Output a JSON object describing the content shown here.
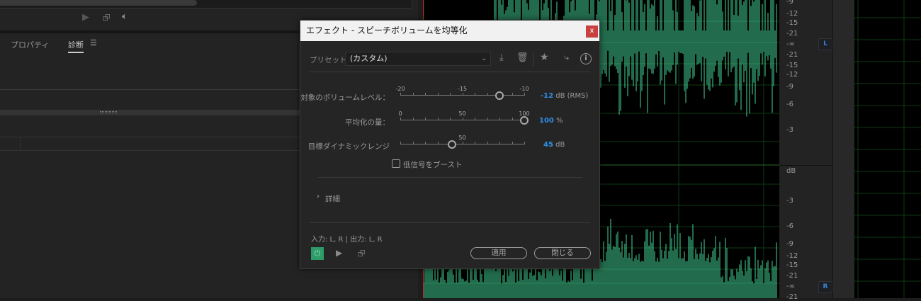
{
  "left_panel": {
    "tabs": [
      {
        "label": "プロパティ"
      },
      {
        "label": "診断",
        "active": true
      }
    ],
    "menu_icon": "hamburger-icon"
  },
  "ruler": {
    "top_labels": [
      "-9",
      "-12",
      "-15",
      "-21",
      "-∞",
      "-21",
      "-15",
      "-12",
      "-9",
      "-6",
      "-3"
    ],
    "bottom_unit": "dB",
    "bottom_labels": [
      "-3",
      "-6",
      "-9",
      "-12",
      "-15",
      "-21",
      "-∞",
      "-21"
    ],
    "left_channel": "L",
    "right_channel": "R"
  },
  "dialog": {
    "title": "エフェクト - スピーチボリュームを均等化",
    "close": "x",
    "preset_label": "プリセット：",
    "preset_value": "(カスタム)",
    "params": [
      {
        "label": "対象のボリュームレベル：",
        "min": -20,
        "max": -10,
        "tick_labels": [
          "-20",
          "-15",
          "-10"
        ],
        "value": -12,
        "value_text": "-12",
        "unit": "dB (RMS)"
      },
      {
        "label": "平均化の量：",
        "min": 0,
        "max": 100,
        "tick_labels": [
          "0",
          "50",
          "100"
        ],
        "value": 100,
        "value_text": "100",
        "unit": "%"
      },
      {
        "label": "目標ダイナミックレンジ",
        "min": 20,
        "max": 80,
        "tick_labels": [
          "50"
        ],
        "value": 45,
        "value_text": "45",
        "unit": "dB"
      }
    ],
    "boost_label": "低信号をブースト",
    "boost_checked": false,
    "details_label": "詳細",
    "io_text": "入力: L, R | 出力: L, R",
    "apply": "適用",
    "close_button": "閉じる",
    "accent": "#2f8ee6",
    "power_color": "#2e9a68"
  },
  "waveform_color": "#45d69a"
}
